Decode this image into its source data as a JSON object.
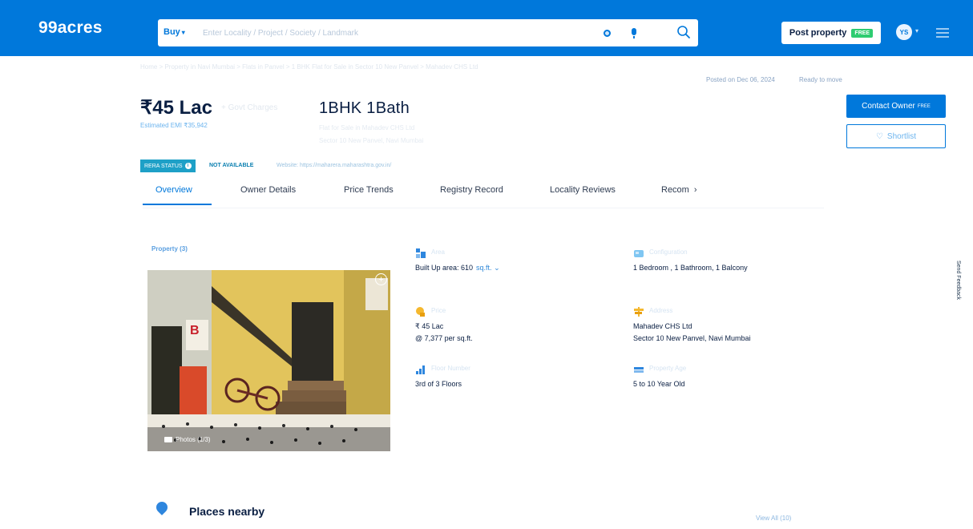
{
  "header": {
    "logo": "99acres",
    "buy_label": "Buy",
    "search_placeholder": "Enter Locality / Project / Society / Landmark",
    "post_property_label": "Post property",
    "free_badge": "FREE",
    "avatar_initials": "YS"
  },
  "listing": {
    "breadcrumb": "Home > Property in Navi Mumbai > Flats in Panvel > 1 BHK Flat for Sale in Sector 10 New Panvel > Mahadev CHS Ltd",
    "posted_on": "Posted on Dec 06, 2024",
    "status": "Ready to move",
    "price": "₹45 Lac",
    "price_sub": "+ Govt Charges",
    "estimated_emi": "Estimated EMI ₹35,942",
    "configuration": "1BHK 1Bath",
    "config_sub1": "Flat for Sale in Mahadev CHS Ltd",
    "config_sub2": "Sector 10 New Panvel, Navi Mumbai",
    "contact_owner_label": "Contact Owner",
    "contact_badge": "FREE",
    "shortlist_label": "Shortlist",
    "rera_status_label": "RERA STATUS",
    "rera_value": "NOT AVAILABLE",
    "rera_website": "Website: https://maharera.maharashtra.gov.in/"
  },
  "tabs": [
    {
      "label": "Overview"
    },
    {
      "label": "Owner Details"
    },
    {
      "label": "Price Trends"
    },
    {
      "label": "Registry Record"
    },
    {
      "label": "Locality Reviews"
    },
    {
      "label": "Recom"
    }
  ],
  "media": {
    "label": "Property (3)",
    "photos_label": "Photos (1/3)"
  },
  "details": {
    "area_label": "Area",
    "area_value": "Built Up area: 610",
    "area_unit": "sq.ft.",
    "config_label": "Configuration",
    "config_value": "1 Bedroom , 1 Bathroom, 1 Balcony",
    "price_label": "Price",
    "price_value": "₹ 45 Lac",
    "price_per": "@ 7,377 per sq.ft.",
    "address_label": "Address",
    "address_line1": "Mahadev CHS Ltd",
    "address_line2": "Sector 10 New Panvel, Navi Mumbai",
    "floor_label": "Floor Number",
    "floor_value": "3rd of 3 Floors",
    "age_label": "Property Age",
    "age_value": "5 to 10 Year Old"
  },
  "places": {
    "title": "Places nearby",
    "view_all": "View All (10)"
  },
  "feedback_label": "Send Feedback",
  "colors": {
    "brand_blue": "#0078db",
    "rera_teal": "#1ea0c7",
    "free_green": "#2ecc71"
  }
}
